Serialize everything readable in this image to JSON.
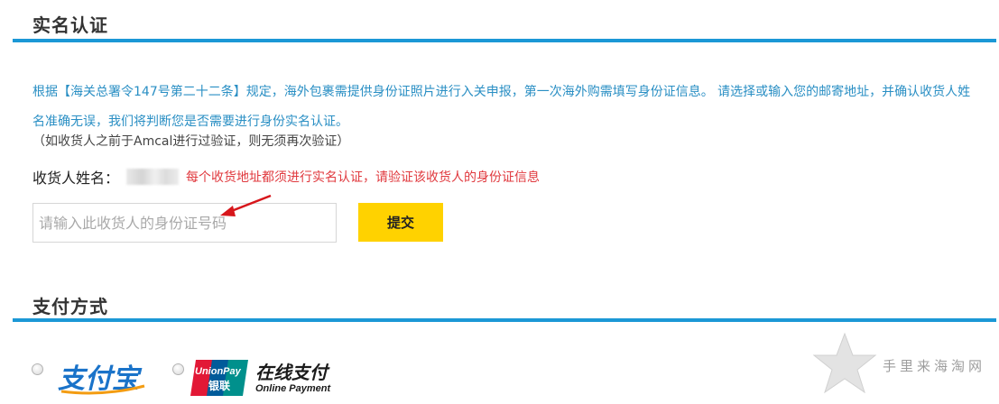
{
  "verification": {
    "title": "实名认证",
    "notice": "根据【海关总署令147号第二十二条】规定，海外包裹需提供身份证照片进行入关申报，第一次海外购需填写身份证信息。 请选择或输入您的邮寄地址，并确认收货人姓名准确无误，我们将判断您是否需要进行身份实名认证。",
    "hint": "（如收货人之前于Amcal进行过验证，则无须再次验证）",
    "recipient_label": "收货人姓名：",
    "recipient_name_visible_tail": "宽",
    "warning": "每个收货地址都须进行实名认证，请验证该收货人的身份证信息",
    "id_input_placeholder": "请输入此收货人的身份证号码",
    "id_input_value": "",
    "submit_label": "提交"
  },
  "payment": {
    "title": "支付方式",
    "options": [
      {
        "logo_text": "支付宝",
        "selected": false
      },
      {
        "logo_text": "在线支付",
        "logo_badge_top": "UnionPay",
        "logo_badge_bottom": "银联",
        "logo_subtext": "Online Payment",
        "selected": false
      }
    ]
  },
  "watermark": {
    "text": "手里来海淘网"
  },
  "colors": {
    "accent_blue": "#1b98d6",
    "notice_text": "#2a8fc4",
    "warning_red": "#e0393e",
    "submit_yellow": "#ffd200",
    "alipay_blue": "#1a73c9",
    "alipay_orange": "#f39c12",
    "unionpay_red": "#e21836",
    "unionpay_blue": "#005b9a",
    "unionpay_green": "#00908c"
  },
  "icons": [
    "red-arrow-icon",
    "radio-icon",
    "alipay-logo-icon",
    "unionpay-logo-icon",
    "star-watermark-icon"
  ]
}
